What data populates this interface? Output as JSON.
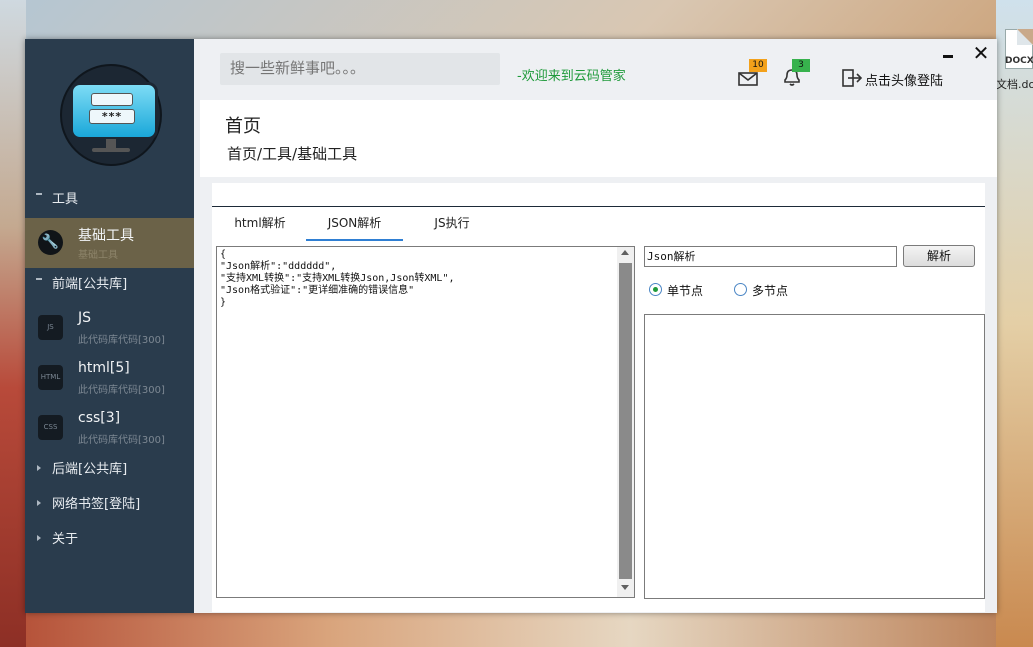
{
  "desktop": {
    "icon_tag": "DOCX",
    "icon_label": "文档.do"
  },
  "sidebar": {
    "logo_text": "***",
    "sections": [
      {
        "label": "工具"
      },
      {
        "label": "前端[公共库]"
      },
      {
        "label": "后端[公共库]"
      },
      {
        "label": "网络书签[登陆]"
      },
      {
        "label": "关于"
      }
    ],
    "items": [
      {
        "title": "基础工具",
        "subtitle": "基础工具",
        "icon": "wrench-icon"
      },
      {
        "title": "JS",
        "subtitle": "此代码库代码[300]",
        "icon_text": "JS"
      },
      {
        "title": "html[5]",
        "subtitle": "此代码库代码[300]",
        "icon_text": "HTML"
      },
      {
        "title": "css[3]",
        "subtitle": "此代码库代码[300]",
        "icon_text": "CSS"
      }
    ]
  },
  "header": {
    "search_placeholder": "搜一些新鲜事吧。。。",
    "welcome": "-欢迎来到云码管家",
    "mail_count": "10",
    "bell_count": "3",
    "login_label": "点击头像登陆",
    "close_glyph": "✕"
  },
  "page": {
    "title": "首页",
    "breadcrumb": "首页/工具/基础工具"
  },
  "tabs": [
    {
      "label": "html解析",
      "active": false
    },
    {
      "label": "JSON解析",
      "active": true
    },
    {
      "label": "JS执行",
      "active": false
    }
  ],
  "editor": {
    "content": "{\n\"Json解析\":\"dddddd\",\n\"支持XML转换\":\"支持XML转换Json,Json转XML\",\n\"Json格式验证\":\"更详细准确的错误信息\"\n}"
  },
  "json_panel": {
    "input_value": "Json解析",
    "parse_button": "解析",
    "radio_single": "单节点",
    "radio_multi": "多节点",
    "selected": "单节点"
  },
  "colors": {
    "sidebar_bg": "#2a3c4d",
    "active_item_bg": "#6b6248",
    "welcome_green": "#1f9a3b",
    "tab_accent": "#2f7fd3"
  }
}
